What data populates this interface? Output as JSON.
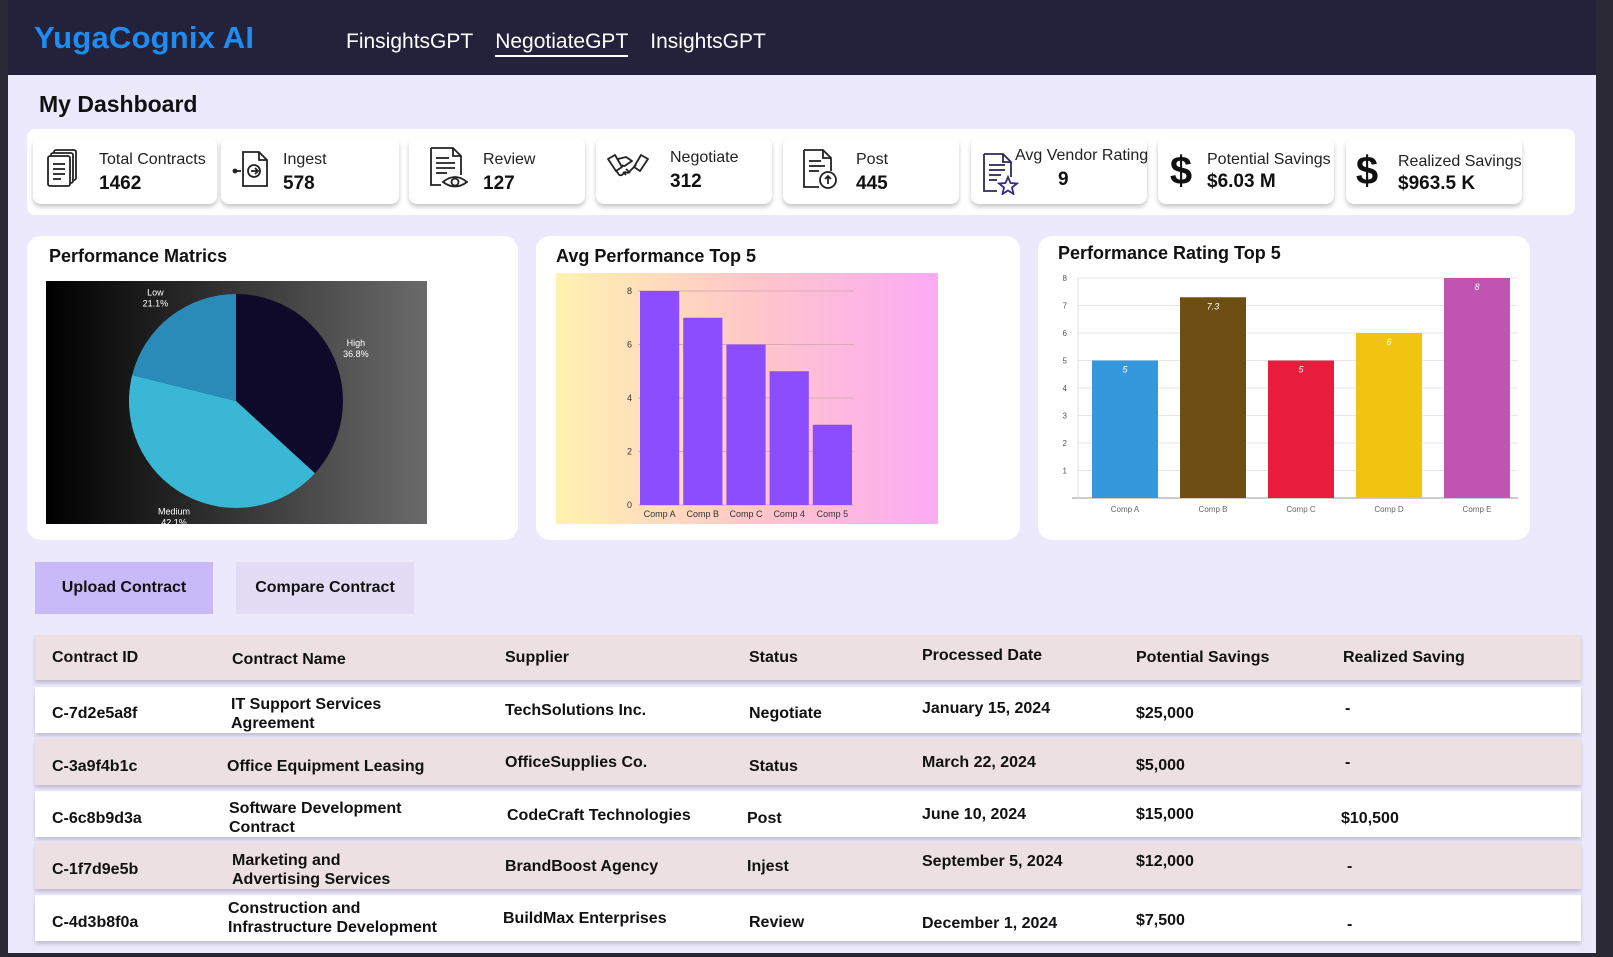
{
  "app": {
    "brand": "YugaCognix AI"
  },
  "nav": [
    {
      "label": "FinsightsGPT",
      "active": false
    },
    {
      "label": "NegotiateGPT",
      "active": true
    },
    {
      "label": "InsightsGPT",
      "active": false
    }
  ],
  "page": {
    "title": "My Dashboard"
  },
  "stats": [
    {
      "label": "Total Contracts",
      "value": "1462",
      "icon": "contracts-stack-icon"
    },
    {
      "label": "Ingest",
      "value": "578",
      "icon": "ingest-document-icon"
    },
    {
      "label": "Review",
      "value": "127",
      "icon": "review-document-eye-icon"
    },
    {
      "label": "Negotiate",
      "value": "312",
      "icon": "handshake-icon"
    },
    {
      "label": "Post",
      "value": "445",
      "icon": "post-document-upload-icon"
    },
    {
      "label": "Avg Vendor Rating",
      "value": "9",
      "icon": "rating-document-star-icon"
    },
    {
      "label": "Potential Savings",
      "value": "$6.03 M",
      "icon": "dollar-icon"
    },
    {
      "label": "Realized Savings",
      "value": "$963.5 K",
      "icon": "dollar-icon"
    }
  ],
  "panels": {
    "pie_title": "Performance Matrics",
    "bar1_title": "Avg Performance Top 5",
    "bar2_title": "Performance Rating Top 5"
  },
  "chart_data": [
    {
      "type": "pie",
      "title": "Performance Matrics",
      "slices": [
        {
          "label": "High",
          "percent": "36.8%",
          "value": 36.8,
          "color": "#0f0a2a"
        },
        {
          "label": "Medium",
          "percent": "42.1%",
          "value": 42.1,
          "color": "#3bb7d6"
        },
        {
          "label": "Low",
          "percent": "21.1%",
          "value": 21.1,
          "color": "#2a8bb9"
        }
      ]
    },
    {
      "type": "bar",
      "title": "Avg Performance Top 5",
      "categories": [
        "Comp A",
        "Comp B",
        "Comp C",
        "Comp 4",
        "Comp 5"
      ],
      "values": [
        8,
        7,
        6,
        5,
        3
      ],
      "ylim": [
        0,
        8
      ],
      "yticks": [
        "0",
        "2",
        "4",
        "6",
        "8"
      ],
      "color": "#8c4dff",
      "grid": true
    },
    {
      "type": "bar",
      "title": "Performance Rating Top 5",
      "categories": [
        "Comp A",
        "Comp B",
        "Comp C",
        "Comp D",
        "Comp E"
      ],
      "values": [
        5,
        7.3,
        5,
        6,
        8
      ],
      "labels": [
        "5",
        "7.3",
        "5",
        "6",
        "8"
      ],
      "colors": [
        "#3598dc",
        "#6f4e14",
        "#e81c3c",
        "#f0c411",
        "#bf55b0"
      ],
      "ylim": [
        0,
        8
      ],
      "yticks": [
        "1",
        "2",
        "3",
        "4",
        "5",
        "6",
        "7",
        "8"
      ],
      "grid": true
    }
  ],
  "buttons": {
    "upload": "Upload Contract",
    "compare": "Compare Contract"
  },
  "table": {
    "headers": [
      "Contract ID",
      "Contract Name",
      "Supplier",
      "Status",
      "Processed Date",
      "Potential Savings",
      "Realized Saving"
    ],
    "rows": [
      {
        "id": "C-7d2e5a8f",
        "name": "IT Support Services Agreement",
        "supplier": "TechSolutions Inc.",
        "status": "Negotiate",
        "date": "January 15, 2024",
        "potential": "$25,000",
        "realized": "-"
      },
      {
        "id": "C-3a9f4b1c",
        "name": "Office Equipment Leasing",
        "supplier": "OfficeSupplies Co.",
        "status": "Status",
        "date": "March 22, 2024",
        "potential": "$5,000",
        "realized": "-"
      },
      {
        "id": "C-6c8b9d3a",
        "name": "Software Development Contract",
        "supplier": "CodeCraft Technologies",
        "status": "Post",
        "date": "June 10, 2024",
        "potential": "$15,000",
        "realized": "$10,500"
      },
      {
        "id": "C-1f7d9e5b",
        "name": "Marketing and Advertising Services",
        "supplier": "BrandBoost Agency",
        "status": "Injest",
        "date": "September 5, 2024",
        "potential": "$12,000",
        "realized": "-"
      },
      {
        "id": "C-4d3b8f0a",
        "name": "Construction and Infrastructure Development",
        "supplier": "BuildMax Enterprises",
        "status": "Review",
        "date": "December 1, 2024",
        "potential": "$7,500",
        "realized": "-"
      }
    ]
  }
}
